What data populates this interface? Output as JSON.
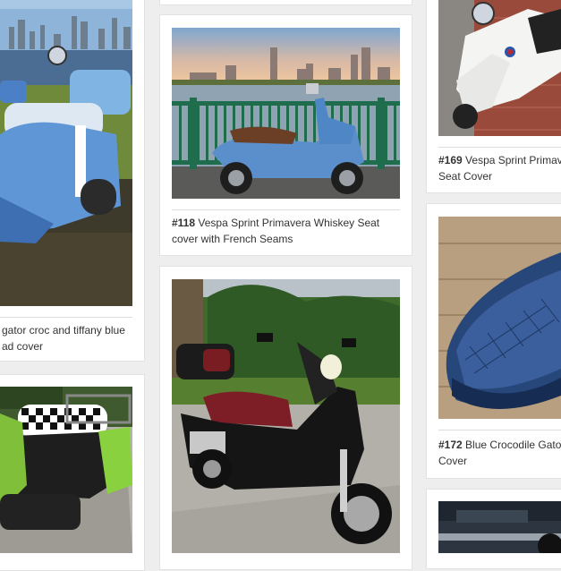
{
  "gallery": {
    "items": [
      {
        "number": "",
        "title": "gator croc and tiffany blue",
        "title_line2": "ad cover"
      },
      {
        "number": "#118",
        "title": "Vespa Sprint Primavera Whiskey Seat",
        "title_line2": "cover with French Seams"
      },
      {
        "number": "#169",
        "title": "Vespa Sprint Primav",
        "title_line2": "Seat Cover"
      },
      {
        "number": "#172",
        "title": "Blue Crocodile Gato",
        "title_line2": "Cover"
      }
    ]
  }
}
